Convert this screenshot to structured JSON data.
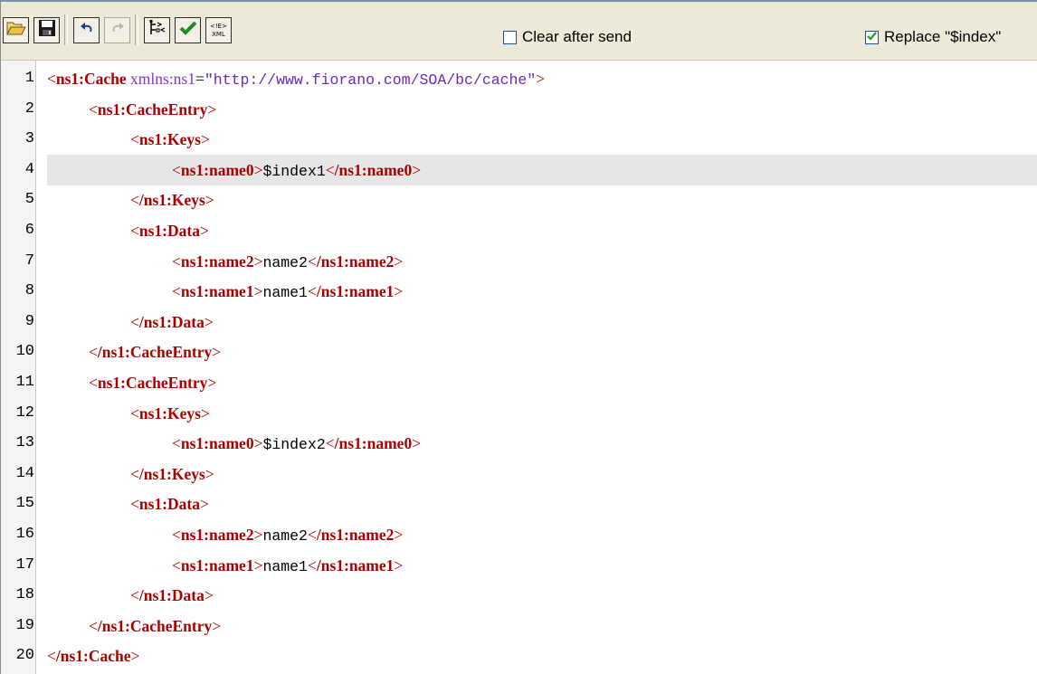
{
  "toolbar": {
    "buttons": [
      {
        "name": "open-button",
        "icon": "folder-open-icon",
        "enabled": true
      },
      {
        "name": "save-button",
        "icon": "floppy-disk-icon",
        "enabled": true
      },
      {
        "name": "undo-button",
        "icon": "undo-icon",
        "enabled": true
      },
      {
        "name": "redo-button",
        "icon": "redo-icon",
        "enabled": false
      },
      {
        "name": "format-xml-button",
        "icon": "tree-format-icon",
        "enabled": true
      },
      {
        "name": "validate-button",
        "icon": "checkmark-icon",
        "enabled": true
      },
      {
        "name": "dtd-xml-button",
        "icon": "dtd-xml-icon",
        "enabled": true
      }
    ],
    "dtd_icon_text_top": "<!E>",
    "dtd_icon_text_bottom": "XML",
    "clear_after_send": {
      "label": "Clear after send",
      "checked": false
    },
    "replace_index": {
      "label": "Replace \"$index\"",
      "checked": true
    }
  },
  "editor": {
    "current_line": 4,
    "colors": {
      "tag": "#aa0000",
      "attribute": "#8833cc",
      "value": "#6a2ab8",
      "text": "#000000",
      "current_line_bg": "#e6e6e6"
    },
    "lines": [
      {
        "number": "1",
        "tag": "ns1:Cache",
        "attr": "xmlns:ns1",
        "value": "\"http://www.fiorano.com/SOA/bc/cache\""
      },
      {
        "number": "2",
        "tag": "ns1:CacheEntry"
      },
      {
        "number": "3",
        "tag": "ns1:Keys"
      },
      {
        "number": "4",
        "tag": "ns1:name0",
        "text": "$index1",
        "close": "/ns1:name0"
      },
      {
        "number": "5",
        "tag": "/ns1:Keys"
      },
      {
        "number": "6",
        "tag": "ns1:Data"
      },
      {
        "number": "7",
        "tag": "ns1:name2",
        "text": "name2",
        "close": "/ns1:name2"
      },
      {
        "number": "8",
        "tag": "ns1:name1",
        "text": "name1",
        "close": "/ns1:name1"
      },
      {
        "number": "9",
        "tag": "/ns1:Data"
      },
      {
        "number": "10",
        "tag": "/ns1:CacheEntry"
      },
      {
        "number": "11",
        "tag": "ns1:CacheEntry"
      },
      {
        "number": "12",
        "tag": "ns1:Keys"
      },
      {
        "number": "13",
        "tag": "ns1:name0",
        "text": "$index2",
        "close": "/ns1:name0"
      },
      {
        "number": "14",
        "tag": "/ns1:Keys"
      },
      {
        "number": "15",
        "tag": "ns1:Data"
      },
      {
        "number": "16",
        "tag": "ns1:name2",
        "text": "name2",
        "close": "/ns1:name2"
      },
      {
        "number": "17",
        "tag": "ns1:name1",
        "text": "name1",
        "close": "/ns1:name1"
      },
      {
        "number": "18",
        "tag": "/ns1:Data"
      },
      {
        "number": "19",
        "tag": "/ns1:CacheEntry"
      },
      {
        "number": "20",
        "tag": "/ns1:Cache"
      }
    ]
  }
}
